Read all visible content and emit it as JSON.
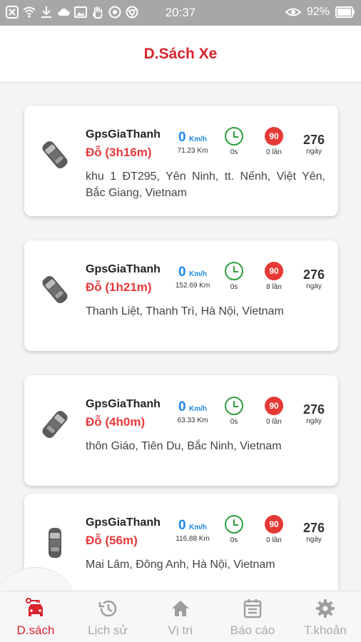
{
  "statusbar": {
    "time": "20:37",
    "battery": "92%",
    "left_icons": [
      "close-icon",
      "wifi-icon",
      "download-icon",
      "cloud-icon",
      "image-icon",
      "hand-icon",
      "target-icon",
      "chrome-icon"
    ],
    "right_icons": [
      "eye-icon",
      "signal-icon",
      "battery-icon"
    ]
  },
  "header": {
    "title": "D.Sách Xe"
  },
  "vehicles": [
    {
      "name": "GpsGiaThanh",
      "status": "Đỗ (3h16m)",
      "speed": "0",
      "speed_unit": "Km/h",
      "distance": "71.23 Km",
      "idle": "0s",
      "speed_limit": "90",
      "violations": "0 lần",
      "days": "276",
      "days_label": "ngày",
      "address": "khu 1 ĐT295, Yên Ninh, tt. Nếnh, Việt Yên, Bắc Giang, Vietnam"
    },
    {
      "name": "GpsGiaThanh",
      "status": "Đỗ (1h21m)",
      "speed": "0",
      "speed_unit": "Km/h",
      "distance": "152.69 Km",
      "idle": "0s",
      "speed_limit": "90",
      "violations": "8 lần",
      "days": "276",
      "days_label": "ngày",
      "address": "Thanh Liệt, Thanh Trì, Hà Nội, Vietnam"
    },
    {
      "name": "GpsGiaThanh",
      "status": "Đỗ (4h0m)",
      "speed": "0",
      "speed_unit": "Km/h",
      "distance": "63.33 Km",
      "idle": "0s",
      "speed_limit": "90",
      "violations": "0 lần",
      "days": "276",
      "days_label": "ngày",
      "address": "thôn Giáo, Tiên Du, Bắc Ninh, Vietnam"
    },
    {
      "name": "GpsGiaThanh",
      "status": "Đỗ (56m)",
      "speed": "0",
      "speed_unit": "Km/h",
      "distance": "116.88 Km",
      "idle": "0s",
      "speed_limit": "90",
      "violations": "0 lần",
      "days": "276",
      "days_label": "ngày",
      "address": "Mai Lâm, Đông Anh, Hà Nội, Vietnam"
    }
  ],
  "nav": [
    {
      "label": "D.sách",
      "icon": "car-key-icon",
      "active": true
    },
    {
      "label": "Lịch sử",
      "icon": "history-icon",
      "active": false
    },
    {
      "label": "Vị trí",
      "icon": "home-icon",
      "active": false
    },
    {
      "label": "Báo cáo",
      "icon": "calendar-icon",
      "active": false
    },
    {
      "label": "T.khoản",
      "icon": "gear-icon",
      "active": false
    }
  ],
  "colors": {
    "accent": "#d9232d",
    "status": "#e63a3a",
    "speed": "#1e88e5",
    "clock": "#2e9e3e",
    "limit": "#e53935"
  }
}
